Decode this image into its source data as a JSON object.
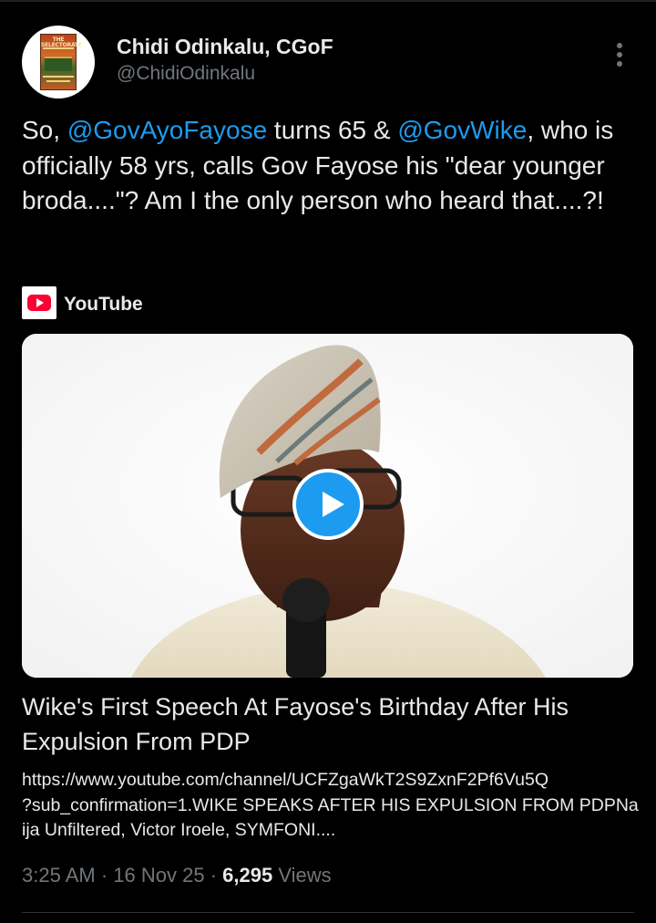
{
  "author": {
    "display_name": "Chidi Odinkalu, CGoF",
    "handle": "@ChidiOdinkalu",
    "avatar_book_title": "THE SELECTORATE"
  },
  "tweet": {
    "text_before": "So, ",
    "mention_1": "@GovAyoFayose",
    "text_middle": " turns 65 & ",
    "mention_2": "@GovWike",
    "text_after": ", who is officially 58 yrs, calls Gov Fayose his \"dear younger broda....\"? Am I the only person who heard that....?!"
  },
  "link_card": {
    "source": "YouTube",
    "title": "Wike's First Speech At Fayose's Birthday After His Expulsion From PDP",
    "description": "https://www.youtube.com/channel/UCFZgaWkT2S9ZxnF2Pf6Vu5Q\n?sub_confirmation=1.WIKE SPEAKS AFTER HIS EXPULSION FROM PDPNaija Unfiltered, Victor Iroele, SYMFONI...."
  },
  "meta": {
    "time": "3:25 AM",
    "separator": " · ",
    "date": "16 Nov 25",
    "views_count": "6,295",
    "views_label": " Views"
  },
  "icons": {
    "more": "more-vertical-icon",
    "play": "play-icon",
    "source": "youtube-icon"
  },
  "colors": {
    "background": "#000000",
    "text": "#e7e9ea",
    "secondary": "#71767b",
    "accent": "#1d9bf0",
    "youtube_red": "#ff0033"
  }
}
